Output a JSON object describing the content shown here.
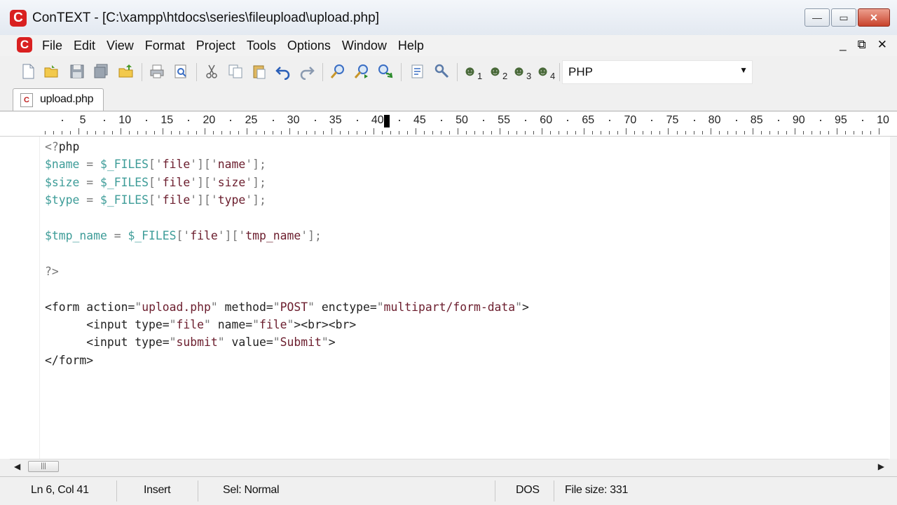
{
  "window": {
    "title": "ConTEXT - [C:\\xampp\\htdocs\\series\\fileupload\\upload.php]",
    "logo_letter": "C",
    "controls": {
      "minimize": "—",
      "maximize": "▭",
      "close": "✕"
    }
  },
  "menubar": {
    "items": [
      "File",
      "Edit",
      "View",
      "Format",
      "Project",
      "Tools",
      "Options",
      "Window",
      "Help"
    ],
    "mdi_controls": {
      "minimize": "_",
      "restore": "⧉",
      "close": "✕"
    }
  },
  "toolbar": {
    "language": "PHP",
    "icons": [
      "new-file-icon",
      "open-file-icon",
      "save-icon",
      "save-all-icon",
      "open-folder-icon",
      "print-icon",
      "print-preview-icon",
      "cut-icon",
      "copy-icon",
      "paste-icon",
      "undo-icon",
      "redo-icon",
      "find-icon",
      "find-next-icon",
      "replace-icon",
      "export-icon",
      "settings-icon",
      "user-tool-1-icon",
      "user-tool-2-icon",
      "user-tool-3-icon",
      "user-tool-4-icon"
    ],
    "user_tool_numbers": [
      "1",
      "2",
      "3",
      "4"
    ]
  },
  "tabs": [
    {
      "label": "upload.php",
      "active": true
    }
  ],
  "ruler": {
    "labels": [
      "5",
      "10",
      "15",
      "20",
      "25",
      "30",
      "35",
      "40",
      "45",
      "50",
      "55",
      "60",
      "65",
      "70",
      "75",
      "80",
      "85",
      "90",
      "95",
      "10"
    ],
    "cursor_column": 41
  },
  "editor": {
    "language": "PHP",
    "lines": [
      "<?php",
      "$name = $_FILES['file']['name'];",
      "$size = $_FILES['file']['size'];",
      "$type = $_FILES['file']['type'];",
      "",
      "$tmp_name = $_FILES['file']['tmp_name'];",
      "",
      "?>",
      "",
      "<form action=\"upload.php\" method=\"POST\" enctype=\"multipart/form-data\">",
      "\t<input type=\"file\" name=\"file\"><br><br>",
      "\t<input type=\"submit\" value=\"Submit\">",
      "</form>"
    ]
  },
  "colors": {
    "variable": "#3d9c98",
    "string": "#6b1d2d",
    "text": "#222222",
    "accent": "#d92020"
  },
  "statusbar": {
    "position": "Ln 6, Col 41",
    "mode": "Insert",
    "selection": "Sel: Normal",
    "line_endings": "DOS",
    "file_size": "File size: 331"
  }
}
